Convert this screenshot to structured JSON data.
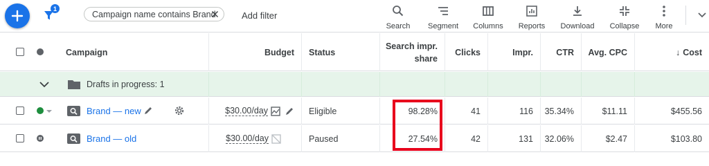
{
  "toolbar": {
    "filter_count": "1",
    "filter_chip": "Campaign name contains Brand",
    "add_filter": "Add filter",
    "tools": [
      {
        "label": "Search",
        "icon": "search-icon"
      },
      {
        "label": "Segment",
        "icon": "segment-icon"
      },
      {
        "label": "Columns",
        "icon": "columns-icon"
      },
      {
        "label": "Reports",
        "icon": "reports-icon"
      },
      {
        "label": "Download",
        "icon": "download-icon"
      },
      {
        "label": "Collapse",
        "icon": "collapse-icon"
      },
      {
        "label": "More",
        "icon": "more-vert-icon"
      }
    ]
  },
  "table": {
    "headers": {
      "campaign": "Campaign",
      "budget": "Budget",
      "status": "Status",
      "search_impr_share_1": "Search impr.",
      "search_impr_share_2": "share",
      "clicks": "Clicks",
      "impr": "Impr.",
      "ctr": "CTR",
      "avg_cpc": "Avg. CPC",
      "cost": "Cost",
      "cost_sort": "↓"
    },
    "drafts": "Drafts in progress: 1",
    "rows": [
      {
        "name": "Brand — new",
        "status_color": "#1e8e3e",
        "budget": "$30.00/day",
        "status": "Eligible",
        "search_impr_share": "98.28%",
        "clicks": "41",
        "impr": "116",
        "ctr": "35.34%",
        "avg_cpc": "$11.11",
        "cost": "$455.56"
      },
      {
        "name": "Brand — old",
        "status_color": "#5f6368",
        "budget": "$30.00/day",
        "status": "Paused",
        "search_impr_share": "27.54%",
        "clicks": "42",
        "impr": "131",
        "ctr": "32.06%",
        "avg_cpc": "$2.47",
        "cost": "$103.80"
      }
    ]
  },
  "colors": {
    "accent": "#1a73e8",
    "draft_bg": "#e6f4ea",
    "highlight": "#e8001c"
  }
}
